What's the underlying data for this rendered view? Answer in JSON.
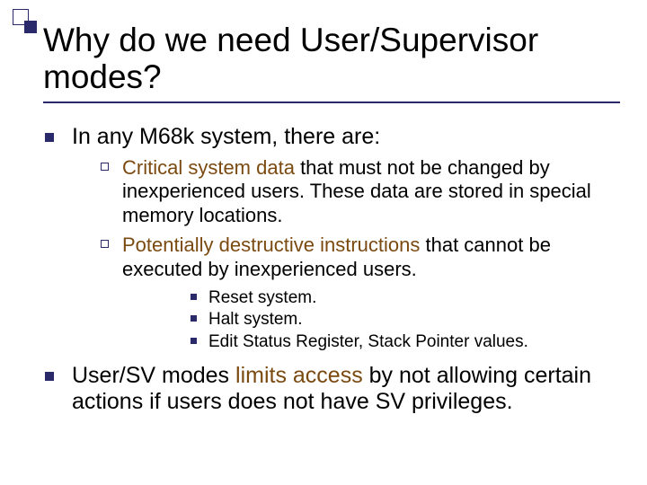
{
  "title": "Why do we need User/Supervisor modes?",
  "bullets": [
    {
      "text": "In any M68k system, there are:",
      "sub": [
        {
          "pre": "",
          "emph": "Critical system data",
          "post": " that must not be changed by inexperienced users. These data are stored in special memory locations."
        },
        {
          "pre": "",
          "emph": "Potentially destructive instructions",
          "post": " that cannot be executed by inexperienced users.",
          "sub": [
            "Reset system.",
            "Halt system.",
            "Edit Status Register, Stack Pointer values."
          ]
        }
      ]
    },
    {
      "pre": "User/SV modes ",
      "emph": "limits access",
      "post": " by not allowing certain actions if users does not have SV privileges."
    }
  ]
}
